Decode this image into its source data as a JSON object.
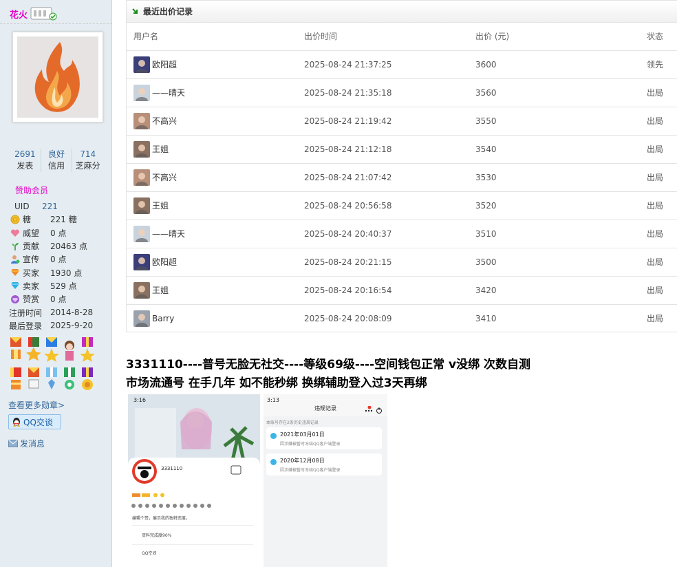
{
  "sidebar": {
    "username": "花火",
    "stats": [
      {
        "num": "2691",
        "label": "发表"
      },
      {
        "num": "良好",
        "label": "信用"
      },
      {
        "num": "714",
        "label": "芝麻分"
      }
    ],
    "level": "赞助会员",
    "info": [
      {
        "key": "UID",
        "value": "221",
        "icon": "none",
        "link": true
      },
      {
        "key": "糖",
        "value": "221 糖",
        "icon": "coin-icon"
      },
      {
        "key": "威望",
        "value": "0 点",
        "icon": "heart-icon"
      },
      {
        "key": "贡献",
        "value": "20463 点",
        "icon": "sprout-icon"
      },
      {
        "key": "宣传",
        "value": "0 点",
        "icon": "user-icon"
      },
      {
        "key": "买家",
        "value": "1930 点",
        "icon": "diamond-orange-icon"
      },
      {
        "key": "卖家",
        "value": "529 点",
        "icon": "diamond-blue-icon"
      },
      {
        "key": "赞赏",
        "value": "0 点",
        "icon": "diamond-purple-icon"
      },
      {
        "key": "注册时间",
        "value": "2014-8-28",
        "icon": "none",
        "wide": true
      },
      {
        "key": "最后登录",
        "value": "2025-9-20",
        "icon": "none",
        "wide": true
      }
    ],
    "more_medals": "查看更多勋章>",
    "qq_button": "QQ交谈",
    "send_message": "发消息"
  },
  "bids": {
    "title": "最近出价记录",
    "columns": [
      "用户名",
      "出价时间",
      "出价 (元)",
      "状态"
    ],
    "rows": [
      {
        "user": "欧阳超",
        "time": "2025-08-24 21:37:25",
        "price": "3600",
        "status": "领先",
        "lead": true,
        "ava": "#3a3f7a"
      },
      {
        "user": "——晴天",
        "time": "2025-08-24 21:35:18",
        "price": "3560",
        "status": "出局",
        "lead": false,
        "ava": "#c9d3dd"
      },
      {
        "user": "不高兴",
        "time": "2025-08-24 21:19:42",
        "price": "3550",
        "status": "出局",
        "lead": false,
        "ava": "#b8907a"
      },
      {
        "user": "王姐",
        "time": "2025-08-24 21:12:18",
        "price": "3540",
        "status": "出局",
        "lead": false,
        "ava": "#8a7060"
      },
      {
        "user": "不高兴",
        "time": "2025-08-24 21:07:42",
        "price": "3530",
        "status": "出局",
        "lead": false,
        "ava": "#b8907a"
      },
      {
        "user": "王姐",
        "time": "2025-08-24 20:56:58",
        "price": "3520",
        "status": "出局",
        "lead": false,
        "ava": "#8a7060"
      },
      {
        "user": "——晴天",
        "time": "2025-08-24 20:40:37",
        "price": "3510",
        "status": "出局",
        "lead": false,
        "ava": "#c9d3dd"
      },
      {
        "user": "欧阳超",
        "time": "2025-08-24 20:21:15",
        "price": "3500",
        "status": "出局",
        "lead": false,
        "ava": "#3a3f7a"
      },
      {
        "user": "王姐",
        "time": "2025-08-24 20:16:54",
        "price": "3420",
        "status": "出局",
        "lead": false,
        "ava": "#8a7060"
      },
      {
        "user": "Barry",
        "time": "2025-08-24 20:08:09",
        "price": "3410",
        "status": "出局",
        "lead": false,
        "ava": "#9aa3ad"
      }
    ]
  },
  "post": {
    "line1": "3331110----普号无脸无社交----等级69级----空间钱包正常 v没绑 次数自测",
    "line2": "市场流通号 在手几年  如不能秒绑  换绑辅助登入过3天再绑"
  },
  "phone1": {
    "status_time": "3:16",
    "qq_name": "3331110",
    "profile_progress": "资料完成度90%",
    "qzone": "QQ空间",
    "edit_sign": "编辑个签，展示我的独特态度。"
  },
  "phone2": {
    "status_time": "3:13",
    "title": "违规记录",
    "note": "本账号存在2条历史违规记录",
    "records": [
      {
        "date": "2021年03月01日",
        "desc": "因涉嫌被暂时冻结QQ客户端登录"
      },
      {
        "date": "2020年12月08日",
        "desc": "因涉嫌被暂时冻结QQ客户端登录"
      }
    ]
  }
}
